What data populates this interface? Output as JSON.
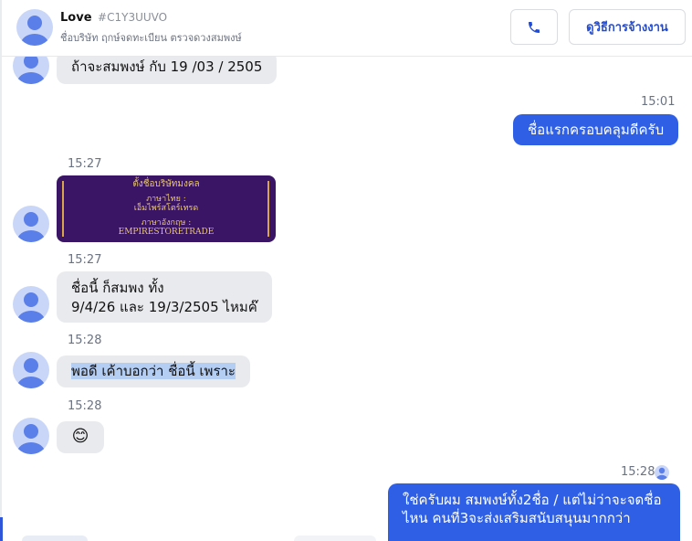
{
  "header": {
    "name": "Love",
    "code": "#C1Y3UUVO",
    "subtitle": "ชื่อบริษัท ฤกษ์จดทะเบียน ตรวจดวงสมพงษ์",
    "hire_button": "ดูวิธีการจ้างงาน"
  },
  "messages": {
    "m1": "ถ้าจะสมพงษ์ กับ 19 /03 / 2505",
    "m2_time": "15:01",
    "m2": "ชื่อแรกครอบคลุมดีครับ",
    "m3_time": "15:27",
    "image": {
      "title": "ตั้งชื่อบริษัทมงคล",
      "thai_label": "ภาษาไทย :",
      "thai_name": "เอ็มไพร์สโตร์เทรด",
      "eng_label": "ภาษาอังกฤษ :",
      "eng_name": "EMPIRESTORETRADE"
    },
    "m4_time": "15:27",
    "m4_line1": "ชื่อนี้ ก็สมพง ทั้ง",
    "m4_line2": "9/4/26 และ 19/3/2505 ไหมค๊",
    "m5_time": "15:28",
    "m5": "พอดี เค้าบอกว่า ชื่อนี้ เพราะ",
    "m6_time": "15:28",
    "m6": "😊",
    "m7_time": "15:28",
    "m7_line1": "ใช่ครับผม สมพงษ์ทั้ง2ชื่อ / แต่ไม่ว่าจะจดชื่อ",
    "m7_line2": "ไหน คนที่3จะส่งเสริมสนับสนุนมากกว่า"
  },
  "colors": {
    "accent": "#2f5fe4",
    "incoming_bubble": "#e9eaee",
    "highlight": "#b4cdf3",
    "image_bg": "#3a1566",
    "image_text": "#e8c66c"
  },
  "icons": [
    "user-avatar-icon",
    "phone-icon"
  ]
}
